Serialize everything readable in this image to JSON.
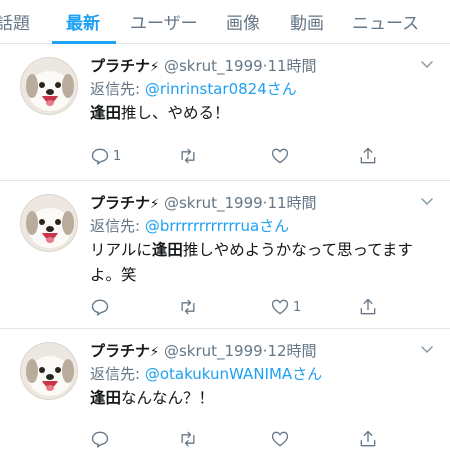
{
  "tabs": [
    {
      "label": "話題"
    },
    {
      "label": "最新",
      "active": true
    },
    {
      "label": "ユーザー"
    },
    {
      "label": "画像"
    },
    {
      "label": "動画"
    },
    {
      "label": "ニュース"
    }
  ],
  "tweets": [
    {
      "name": "プラチナ",
      "bolt": "⚡",
      "handle": "@skrut_1999",
      "separator": "·",
      "time": "11時間",
      "reply_prefix": "返信先: ",
      "reply_to": "@rinrinstar0824さん",
      "text_bold": "逢田",
      "text_rest": "推し、やめる！",
      "reply_count": "1",
      "like_count": ""
    },
    {
      "name": "プラチナ",
      "bolt": "⚡",
      "handle": "@skrut_1999",
      "separator": "·",
      "time": "11時間",
      "reply_prefix": "返信先: ",
      "reply_to": "@brrrrrrrrrrrruaさん",
      "text_pre": "リアルに",
      "text_bold": "逢田",
      "text_rest": "推しやめようかなって思ってますよ。笑",
      "reply_count": "",
      "like_count": "1"
    },
    {
      "name": "プラチナ",
      "bolt": "⚡",
      "handle": "@skrut_1999",
      "separator": "·",
      "time": "12時間",
      "reply_prefix": "返信先: ",
      "reply_to": "@otakukunWANIMAさん",
      "text_bold": "逢田",
      "text_rest": "なんなん？！",
      "reply_count": "",
      "like_count": ""
    }
  ],
  "icons": {
    "reply": "reply-icon",
    "retweet": "retweet-icon",
    "like": "heart-icon",
    "share": "share-icon",
    "menu": "chevron-down-icon"
  },
  "colors": {
    "accent": "#1da1f2",
    "secondary_text": "#657786",
    "divider": "#e1e8ed"
  }
}
